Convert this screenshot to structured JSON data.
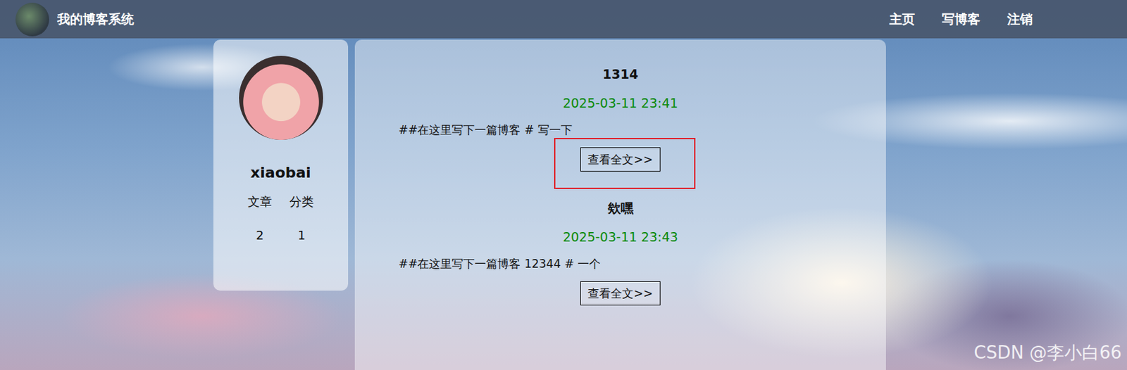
{
  "nav": {
    "title": "我的博客系统",
    "links": [
      "主页",
      "写博客",
      "注销"
    ]
  },
  "profile": {
    "name": "xiaobai",
    "stats": [
      {
        "label": "文章",
        "value": "2"
      },
      {
        "label": "分类",
        "value": "1"
      }
    ]
  },
  "blogs": [
    {
      "title": "1314",
      "date": "2025-03-11 23:41",
      "content": "##在这里写下一篇博客 # 写一下",
      "button": "查看全文>>",
      "highlighted": true
    },
    {
      "title": "欸嘿",
      "date": "2025-03-11 23:43",
      "content": "##在这里写下一篇博客 12344 # 一个",
      "button": "查看全文>>",
      "highlighted": false
    }
  ],
  "watermark": "CSDN @李小白66"
}
